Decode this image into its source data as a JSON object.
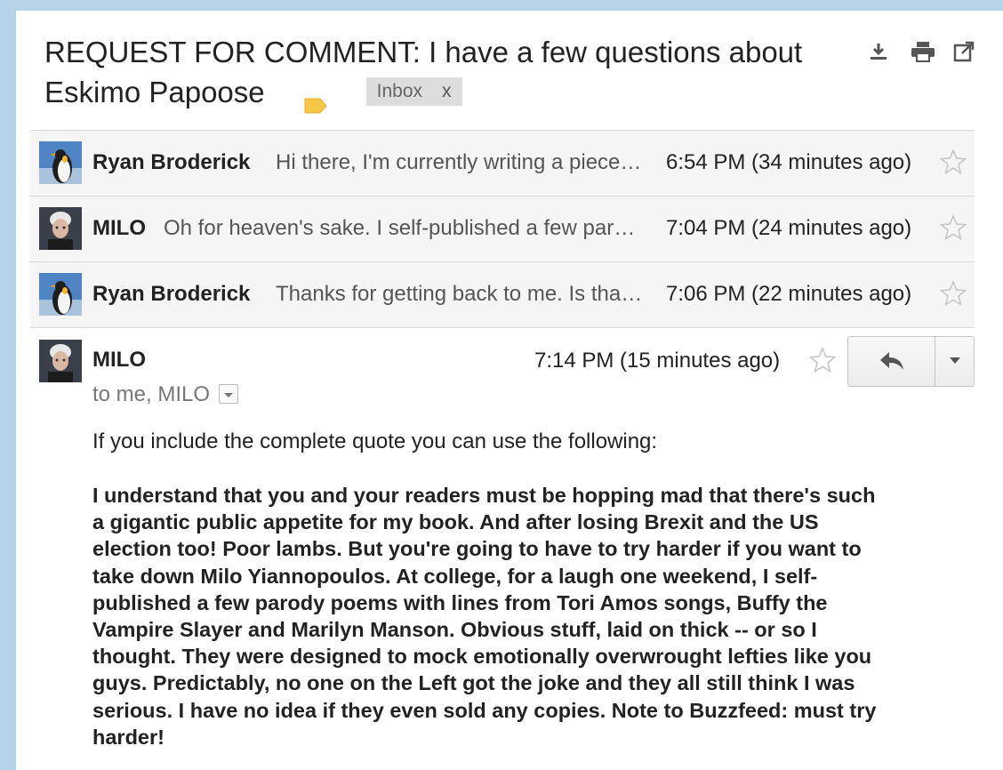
{
  "subject": {
    "title": "REQUEST FOR COMMENT: I have a few questions about Eskimo Papoose",
    "label_color": "#f6c744",
    "chip_label": "Inbox",
    "chip_close": "x",
    "icons": [
      "download-icon",
      "print-icon",
      "open-in-new-window-icon"
    ]
  },
  "thread": [
    {
      "sender": "Ryan Broderick",
      "snippet": "Hi there, I'm currently writing a piece about Eskimo Papoose",
      "time": "6:54 PM (34 minutes ago)",
      "avatar": "penguin",
      "starred": false
    },
    {
      "sender": "MILO",
      "snippet": "Oh for heaven's sake. I self-published a few parody poems",
      "time": "7:04 PM (24 minutes ago)",
      "avatar": "milo",
      "starred": false
    },
    {
      "sender": "Ryan Broderick",
      "snippet": "Thanks for getting back to me. Is that an official statement",
      "time": "7:06 PM (22 minutes ago)",
      "avatar": "penguin",
      "starred": false
    }
  ],
  "open_message": {
    "sender": "MILO",
    "time": "7:14 PM (15 minutes ago)",
    "to_line": "to me, MILO",
    "intro": "If you include the complete quote you can use the following:",
    "quote": "I understand that you and your readers must be hopping mad that there's such\na gigantic public appetite for my book. And after losing Brexit and the US\nelection too! Poor lambs. But you're going to have to try harder if you want to\ntake down Milo Yiannopoulos. At college, for a laugh one weekend, I self-\npublished a few parody poems with lines from Tori Amos songs, Buffy the\nVampire Slayer and Marilyn Manson. Obvious stuff, laid on thick -- or so I\n thought. They were designed to mock emotionally overwrought lefties like you\nguys. Predictably, no one on the Left got the joke and they all still think I was\nserious. I have no idea if they even sold any copies. Note to Buzzfeed: must try\nharder!"
  },
  "colors": {
    "window_background": "#b7d3ea",
    "row_background": "#f5f5f5",
    "text": "#222222",
    "muted": "#555555"
  }
}
